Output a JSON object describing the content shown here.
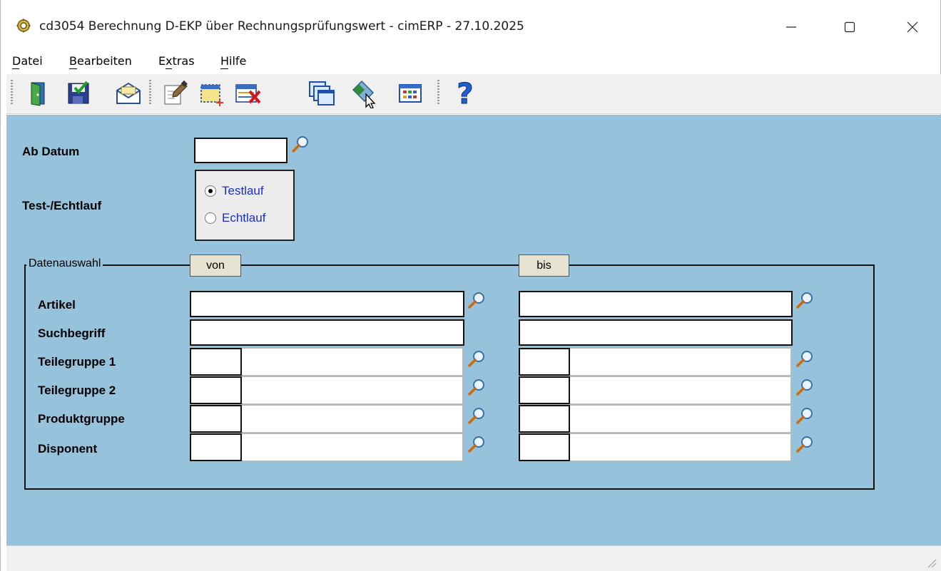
{
  "window": {
    "title": "cd3054 Berechnung D-EKP über Rechnungsprüfungswert - cimERP - 27.10.2025"
  },
  "menu": {
    "items": [
      {
        "label": "Datei"
      },
      {
        "label": "Bearbeiten"
      },
      {
        "label": "Extras"
      },
      {
        "label": "Hilfe"
      }
    ]
  },
  "toolbar": {
    "buttons": [
      {
        "icon": "exit-door-icon"
      },
      {
        "icon": "save-icon"
      },
      {
        "icon": "mail-icon"
      },
      {
        "icon": "edit-document-icon"
      },
      {
        "icon": "new-record-icon"
      },
      {
        "icon": "delete-record-icon"
      },
      {
        "icon": "windows-icon"
      },
      {
        "icon": "tag-icon"
      },
      {
        "icon": "table-icon"
      },
      {
        "icon": "help-icon"
      }
    ]
  },
  "form": {
    "ab_datum_label": "Ab Datum",
    "ab_datum_value": "",
    "testlauf_label": "Test-/Echtlauf",
    "radio_testlauf": "Testlauf",
    "radio_echtlauf": "Echtlauf",
    "selected_mode": "Testlauf"
  },
  "datenauswahl": {
    "title": "Datenauswahl",
    "von_label": "von",
    "bis_label": "bis",
    "rows": [
      {
        "label": "Artikel",
        "von": "",
        "bis": ""
      },
      {
        "label": "Suchbegriff",
        "von": "",
        "bis": ""
      },
      {
        "label": "Teilegruppe 1",
        "von_code": "",
        "von": "",
        "bis_code": "",
        "bis": ""
      },
      {
        "label": "Teilegruppe 2",
        "von_code": "",
        "von": "",
        "bis_code": "",
        "bis": ""
      },
      {
        "label": "Produktgruppe",
        "von_code": "",
        "von": "",
        "bis_code": "",
        "bis": ""
      },
      {
        "label": "Disponent",
        "von_code": "",
        "von": "",
        "bis_code": "",
        "bis": ""
      }
    ]
  },
  "colors": {
    "form_background": "#97c2dc",
    "radio_text": "#1a2fc2"
  }
}
